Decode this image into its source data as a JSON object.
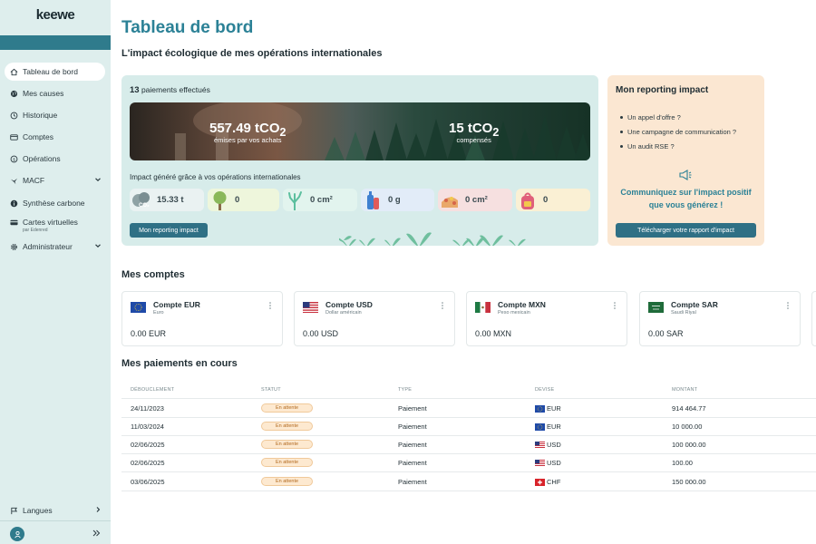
{
  "app": {
    "logo_text": "keewe"
  },
  "sidebar": {
    "items": [
      {
        "label": "Tableau de bord",
        "icon": "home-icon",
        "active": true
      },
      {
        "label": "Mes causes",
        "icon": "globe-icon"
      },
      {
        "label": "Historique",
        "icon": "history-icon"
      },
      {
        "label": "Comptes",
        "icon": "card-icon"
      },
      {
        "label": "Opérations",
        "icon": "dollar-circle-icon"
      },
      {
        "label": "MACF",
        "icon": "plane-icon"
      },
      {
        "label": "Synthèse carbone",
        "icon": "info-icon"
      },
      {
        "label": "Cartes virtuelles",
        "sublabel": "par Edenred",
        "icon": "credit-card-icon"
      },
      {
        "label": "Administrateur",
        "icon": "gear-icon"
      }
    ],
    "language_label": "Langues"
  },
  "page": {
    "title": "Tableau de bord",
    "subtitle": "L'impact écologique de mes opérations internationales"
  },
  "impact": {
    "payments_count": "13",
    "payments_label": " paiements effectués",
    "emitted_value": "557.49 tCO",
    "emitted_sub": "2",
    "emitted_label": "émises par vos achats",
    "compensated_value": "15 tCO",
    "compensated_sub": "2",
    "compensated_label": "compensés",
    "generated_label": "Impact généré grâce à vos opérations internationales",
    "stats": [
      {
        "value": "15.33 t",
        "icon": "co2-cloud-icon"
      },
      {
        "value": "0",
        "icon": "tree-icon"
      },
      {
        "value": "0 cm²",
        "icon": "coral-icon"
      },
      {
        "value": "0 g",
        "icon": "plastic-bottle-icon"
      },
      {
        "value": "0 cm²",
        "icon": "ecosystem-icon"
      },
      {
        "value": "0",
        "icon": "backpack-icon"
      }
    ],
    "report_button": "Mon reporting impact"
  },
  "reporting": {
    "title": "Mon reporting impact",
    "items": [
      "Un appel d'offre ?",
      "Une campagne de communication ?",
      "Un audit RSE ?"
    ],
    "cta_line1": "Communiquez sur l'impact positif",
    "cta_line2": "que vous générez !",
    "download_button": "Télécharger votre rapport d'impact"
  },
  "accounts": {
    "title": "Mes comptes",
    "items": [
      {
        "name": "Compte EUR",
        "currency": "Euro",
        "balance": "0.00 EUR",
        "flag": "eu"
      },
      {
        "name": "Compte USD",
        "currency": "Dollar américain",
        "balance": "0.00 USD",
        "flag": "us"
      },
      {
        "name": "Compte MXN",
        "currency": "Peso mexicain",
        "balance": "0.00 MXN",
        "flag": "mx"
      },
      {
        "name": "Compte SAR",
        "currency": "Saudi Riyal",
        "balance": "0.00 SAR",
        "flag": "sa"
      }
    ]
  },
  "payments": {
    "title": "Mes paiements en cours",
    "headers": [
      "DÉBOUCLEMENT",
      "STATUT",
      "TYPE",
      "DEVISE",
      "MONTANT"
    ],
    "rows": [
      {
        "date": "24/11/2023",
        "status": "En attente",
        "type": "Paiement",
        "currency": "EUR",
        "flag": "eu",
        "amount": "914 464.77"
      },
      {
        "date": "11/03/2024",
        "status": "En attente",
        "type": "Paiement",
        "currency": "EUR",
        "flag": "eu",
        "amount": "10 000.00"
      },
      {
        "date": "02/06/2025",
        "status": "En attente",
        "type": "Paiement",
        "currency": "USD",
        "flag": "us",
        "amount": "100 000.00"
      },
      {
        "date": "02/06/2025",
        "status": "En attente",
        "type": "Paiement",
        "currency": "USD",
        "flag": "us",
        "amount": "100.00"
      },
      {
        "date": "03/06/2025",
        "status": "En attente",
        "type": "Paiement",
        "currency": "CHF",
        "flag": "ch",
        "amount": "150 000.00"
      }
    ]
  },
  "colors": {
    "brand": "#2b8196",
    "sidebar_bg": "#deeeed",
    "button": "#2f7085",
    "impact_card": "#d7ecea",
    "report_card": "#fbe7d2",
    "badge": "#fde9d0"
  }
}
